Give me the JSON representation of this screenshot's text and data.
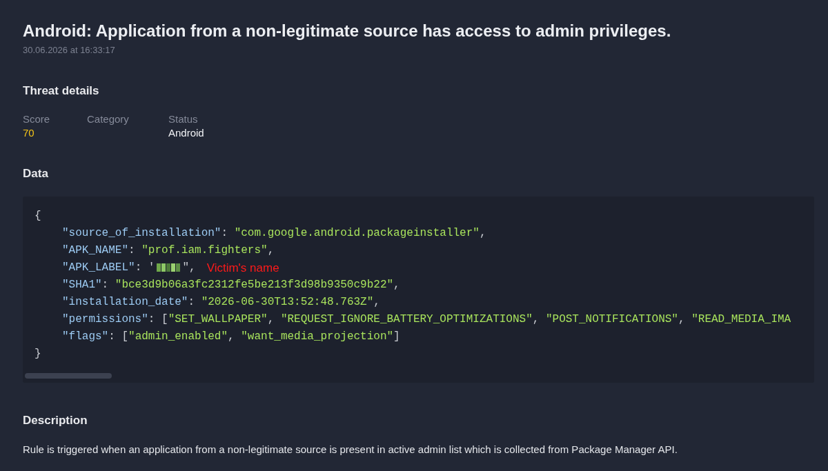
{
  "title": "Android: Application from a non-legitimate source has access to admin privileges.",
  "timestamp": "30.06.2026 at 16:33:17",
  "threat_details": {
    "heading": "Threat details",
    "fields": [
      {
        "label": "Score",
        "value": "70",
        "kind": "score"
      },
      {
        "label": "Category"
      },
      {
        "label": "Status",
        "value": "Android",
        "kind": "plain"
      }
    ]
  },
  "data": {
    "heading": "Data",
    "code": {
      "tokens": [
        {
          "kind": "punct",
          "text": "{"
        }
      ],
      "children": [
        {
          "tokens": [
            {
              "kind": "key",
              "text": "\"source_of_installation\""
            },
            {
              "kind": "punct",
              "text": ": "
            },
            {
              "kind": "string",
              "text": "\"com.google.android.packageinstaller\""
            },
            {
              "kind": "punct",
              "text": ","
            }
          ]
        },
        {
          "tokens": [
            {
              "kind": "key",
              "text": "\"APK_NAME\""
            },
            {
              "kind": "punct",
              "text": ": "
            },
            {
              "kind": "string",
              "text": "\"prof.iam.fighters\""
            },
            {
              "kind": "punct",
              "text": ","
            }
          ]
        },
        {
          "tokens": [
            {
              "kind": "key",
              "text": "\"APK_LABEL\""
            },
            {
              "kind": "punct",
              "text": ": '"
            },
            {
              "kind": "redacted"
            },
            {
              "kind": "punct",
              "text": "\","
            },
            {
              "kind": "annotation",
              "text": "Victim's name"
            }
          ]
        },
        {
          "tokens": [
            {
              "kind": "key",
              "text": "\"SHA1\""
            },
            {
              "kind": "punct",
              "text": ": "
            },
            {
              "kind": "string",
              "text": "\"bce3d9b06a3fc2312fe5be213f3d98b9350c9b22\""
            },
            {
              "kind": "punct",
              "text": ","
            }
          ]
        },
        {
          "tokens": [
            {
              "kind": "key",
              "text": "\"installation_date\""
            },
            {
              "kind": "punct",
              "text": ": "
            },
            {
              "kind": "string",
              "text": "\"2026-06-30T13:52:48.763Z\""
            },
            {
              "kind": "punct",
              "text": ","
            }
          ]
        },
        {
          "tokens": [
            {
              "kind": "key",
              "text": "\"permissions\""
            },
            {
              "kind": "punct",
              "text": ": ["
            },
            {
              "kind": "string",
              "text": "\"SET_WALLPAPER\""
            },
            {
              "kind": "punct",
              "text": ", "
            },
            {
              "kind": "string",
              "text": "\"REQUEST_IGNORE_BATTERY_OPTIMIZATIONS\""
            },
            {
              "kind": "punct",
              "text": ", "
            },
            {
              "kind": "string",
              "text": "\"POST_NOTIFICATIONS\""
            },
            {
              "kind": "punct",
              "text": ", "
            },
            {
              "kind": "string",
              "text": "\"READ_MEDIA_IMA"
            }
          ]
        },
        {
          "tokens": [
            {
              "kind": "key",
              "text": "\"flags\""
            },
            {
              "kind": "punct",
              "text": ": ["
            },
            {
              "kind": "string",
              "text": "\"admin_enabled\""
            },
            {
              "kind": "punct",
              "text": ", "
            },
            {
              "kind": "string",
              "text": "\"want_media_projection\""
            },
            {
              "kind": "punct",
              "text": "]"
            }
          ]
        }
      ],
      "closing": [
        {
          "kind": "punct",
          "text": "}"
        }
      ]
    }
  },
  "description": {
    "heading": "Description",
    "text": "Rule is triggered when an application from a non-legitimate source is present in active admin list which is collected from Package Manager API."
  }
}
